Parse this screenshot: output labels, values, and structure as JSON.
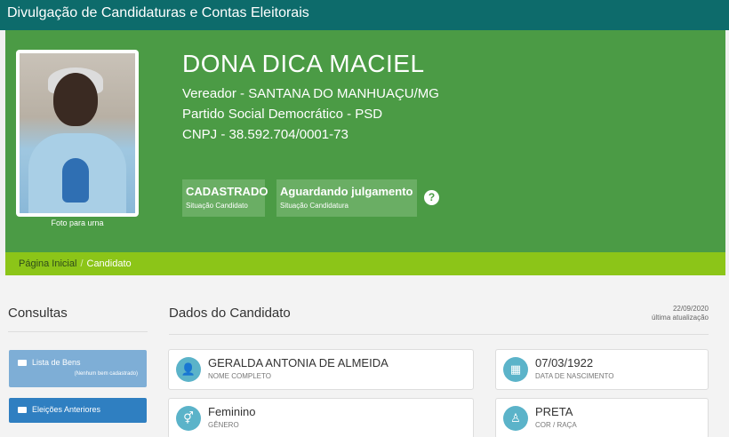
{
  "topbar": {
    "title": "Divulgação de Candidaturas e Contas Eleitorais"
  },
  "candidate": {
    "name": "DONA DICA MACIEL",
    "office_line": "Vereador - SANTANA DO MANHUAÇU/MG",
    "party_line": "Partido Social Democrático - PSD",
    "cnpj_line": "CNPJ - 38.592.704/0001-73",
    "photo_caption": "Foto para urna",
    "photo_icon": "candidate-photo"
  },
  "status": [
    {
      "value": "CADASTRADO",
      "label": "Situação Candidato"
    },
    {
      "value": "Aguardando julgamento",
      "label": "Situação Candidatura"
    }
  ],
  "help_icon": "?",
  "breadcrumb": {
    "home": "Página Inicial",
    "separator": "/",
    "current": "Candidato"
  },
  "sidebar": {
    "title": "Consultas",
    "buttons": [
      {
        "label": "Lista de Bens",
        "sub": "(Nenhum bem cadastrado)"
      },
      {
        "label": "Eleições Anteriores"
      }
    ]
  },
  "main": {
    "title": "Dados do Candidato",
    "update_date": "22/09/2020",
    "update_label": "última atualização",
    "cards": [
      {
        "value": "GERALDA ANTONIA DE ALMEIDA",
        "label": "NOME COMPLETO",
        "icon": "user-icon",
        "glyph": "👤"
      },
      {
        "value": "07/03/1922",
        "label": "DATA DE NASCIMENTO",
        "icon": "calendar-icon",
        "glyph": "▦"
      },
      {
        "value": "Feminino",
        "label": "GÊNERO",
        "icon": "gender-icon",
        "glyph": "⚥"
      },
      {
        "value": "PRETA",
        "label": "COR / RAÇA",
        "icon": "person-icon",
        "glyph": "♙"
      }
    ]
  },
  "colors": {
    "topbar": "#0d6b6b",
    "hero": "#4b9b45",
    "breadcrumb": "#8cc518",
    "accent": "#2f7fc1"
  }
}
